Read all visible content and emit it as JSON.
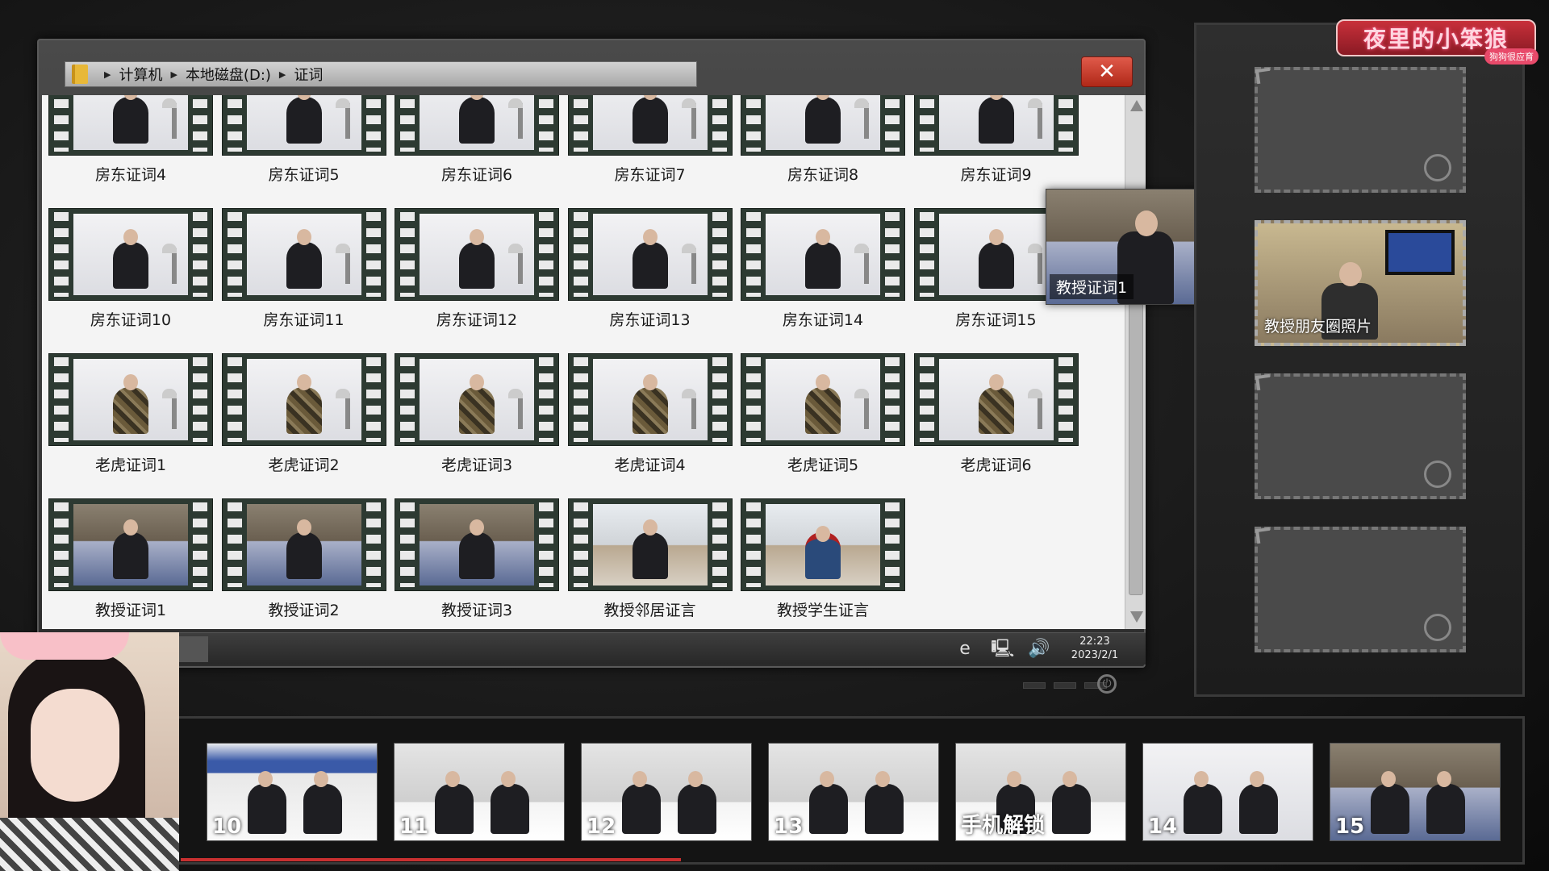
{
  "explorer": {
    "breadcrumb": [
      "计算机",
      "本地磁盘(D:)",
      "证词"
    ],
    "close_symbol": "✕",
    "files": [
      {
        "label": "房东证词4",
        "scene": "white"
      },
      {
        "label": "房东证词5",
        "scene": "white"
      },
      {
        "label": "房东证词6",
        "scene": "white"
      },
      {
        "label": "房东证词7",
        "scene": "white"
      },
      {
        "label": "房东证词8",
        "scene": "white"
      },
      {
        "label": "房东证词9",
        "scene": "white"
      },
      {
        "label": "房东证词10",
        "scene": "white"
      },
      {
        "label": "房东证词11",
        "scene": "white"
      },
      {
        "label": "房东证词12",
        "scene": "white"
      },
      {
        "label": "房东证词13",
        "scene": "white"
      },
      {
        "label": "房东证词14",
        "scene": "white"
      },
      {
        "label": "房东证词15",
        "scene": "white"
      },
      {
        "label": "老虎证词1",
        "scene": "camo"
      },
      {
        "label": "老虎证词2",
        "scene": "camo"
      },
      {
        "label": "老虎证词3",
        "scene": "camo"
      },
      {
        "label": "老虎证词4",
        "scene": "camo"
      },
      {
        "label": "老虎证词5",
        "scene": "camo"
      },
      {
        "label": "老虎证词6",
        "scene": "camo"
      },
      {
        "label": "教授证词1",
        "scene": "sofa"
      },
      {
        "label": "教授证词2",
        "scene": "sofa"
      },
      {
        "label": "教授证词3",
        "scene": "sofa"
      },
      {
        "label": "教授邻居证言",
        "scene": "street"
      },
      {
        "label": "教授学生证言",
        "scene": "street-red"
      }
    ],
    "hover_preview_label": "教授证词1"
  },
  "taskbar": {
    "time": "22:23",
    "date": "2023/2/1",
    "icons": [
      "ie-icon",
      "network-icon",
      "volume-icon"
    ]
  },
  "evidence": {
    "slots": [
      {
        "filled": false,
        "label": ""
      },
      {
        "filled": true,
        "label": "教授朋友圈照片"
      },
      {
        "filled": false,
        "label": ""
      },
      {
        "filled": false,
        "label": ""
      }
    ]
  },
  "logo": {
    "text": "夜里的小笨狼",
    "sub": "狗狗很应育"
  },
  "clips": [
    {
      "num": "10",
      "scene": "police"
    },
    {
      "num": "11",
      "scene": "office"
    },
    {
      "num": "12",
      "scene": "office"
    },
    {
      "num": "13",
      "scene": "office"
    },
    {
      "num": "手机解锁",
      "scene": "office"
    },
    {
      "num": "14",
      "scene": "white"
    },
    {
      "num": "15",
      "scene": "sofa"
    }
  ],
  "colors": {
    "close_button": "#c83828",
    "logo": "#b02430",
    "progress": "#c83030"
  }
}
